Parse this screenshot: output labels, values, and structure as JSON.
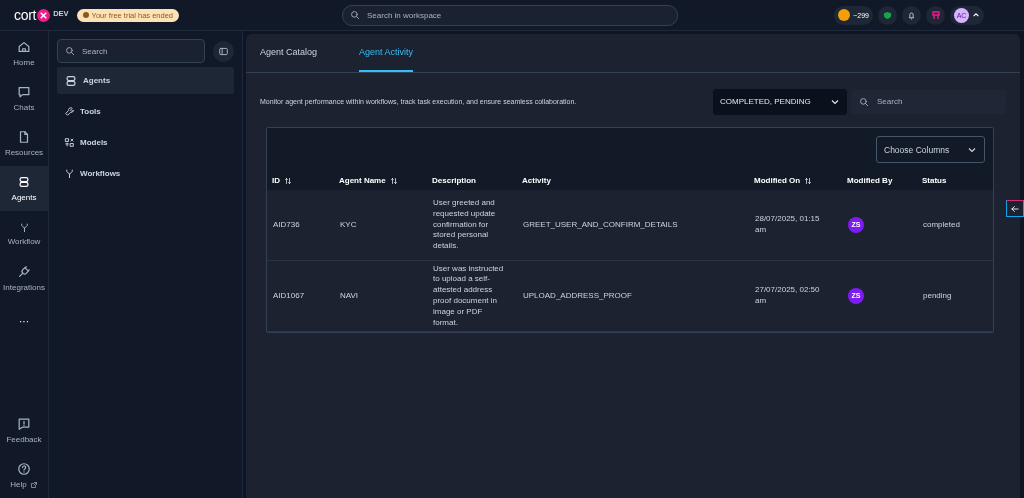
{
  "topbar": {
    "logo_text": "cort",
    "logo_tag": "DEV",
    "trial_badge": "Your free trial has ended",
    "search": {
      "placeholder": "Search in workspace"
    },
    "credits": "~299",
    "avatar": "AC"
  },
  "rail": {
    "items": [
      {
        "label": "Home",
        "selected": false
      },
      {
        "label": "Chats",
        "selected": false
      },
      {
        "label": "Resources",
        "selected": false
      },
      {
        "label": "Agents",
        "selected": true
      },
      {
        "label": "Workflow",
        "selected": false
      },
      {
        "label": "Integrations",
        "selected": false
      },
      {
        "label": "···",
        "selected": false
      }
    ],
    "bottom": [
      {
        "label": "Feedback"
      },
      {
        "label": "Help"
      }
    ]
  },
  "sidebar": {
    "search": {
      "placeholder": "Search"
    },
    "items": [
      {
        "label": "Agents",
        "selected": true
      },
      {
        "label": "Tools",
        "selected": false
      },
      {
        "label": "Models",
        "selected": false
      },
      {
        "label": "Workflows",
        "selected": false
      }
    ]
  },
  "tabs": [
    {
      "label": "Agent Catalog",
      "selected": false
    },
    {
      "label": "Agent Activity",
      "selected": true
    }
  ],
  "intro": "Monitor agent performance within workflows, track task execution, and ensure seamless collaboration.",
  "status_filter": "COMPLETED, PENDING",
  "search": {
    "placeholder": "Search"
  },
  "table": {
    "choose_columns": "Choose Columns",
    "columns": [
      {
        "label": "ID",
        "sortable": true
      },
      {
        "label": "Agent Name",
        "sortable": true
      },
      {
        "label": "Description",
        "sortable": false
      },
      {
        "label": "Activity",
        "sortable": false
      },
      {
        "label": "Modified On",
        "sortable": true
      },
      {
        "label": "Modified By",
        "sortable": false
      },
      {
        "label": "Status",
        "sortable": false
      }
    ],
    "rows": [
      {
        "id": "AID736",
        "agent_name": "KYC",
        "description": "User greeted and requested update confirmation for stored personal details.",
        "activity": "GREET_USER_AND_CONFIRM_DETAILS",
        "modified_on": "28/07/2025, 01:15 am",
        "modified_by": "ZS",
        "status": "completed"
      },
      {
        "id": "AID1067",
        "agent_name": "NAVI",
        "description": "User was instructed to upload a self-attested address proof document in image or PDF format.",
        "activity": "UPLOAD_ADDRESS_PROOF",
        "modified_on": "27/07/2025, 02:50 am",
        "modified_by": "ZS",
        "status": "pending"
      }
    ]
  }
}
